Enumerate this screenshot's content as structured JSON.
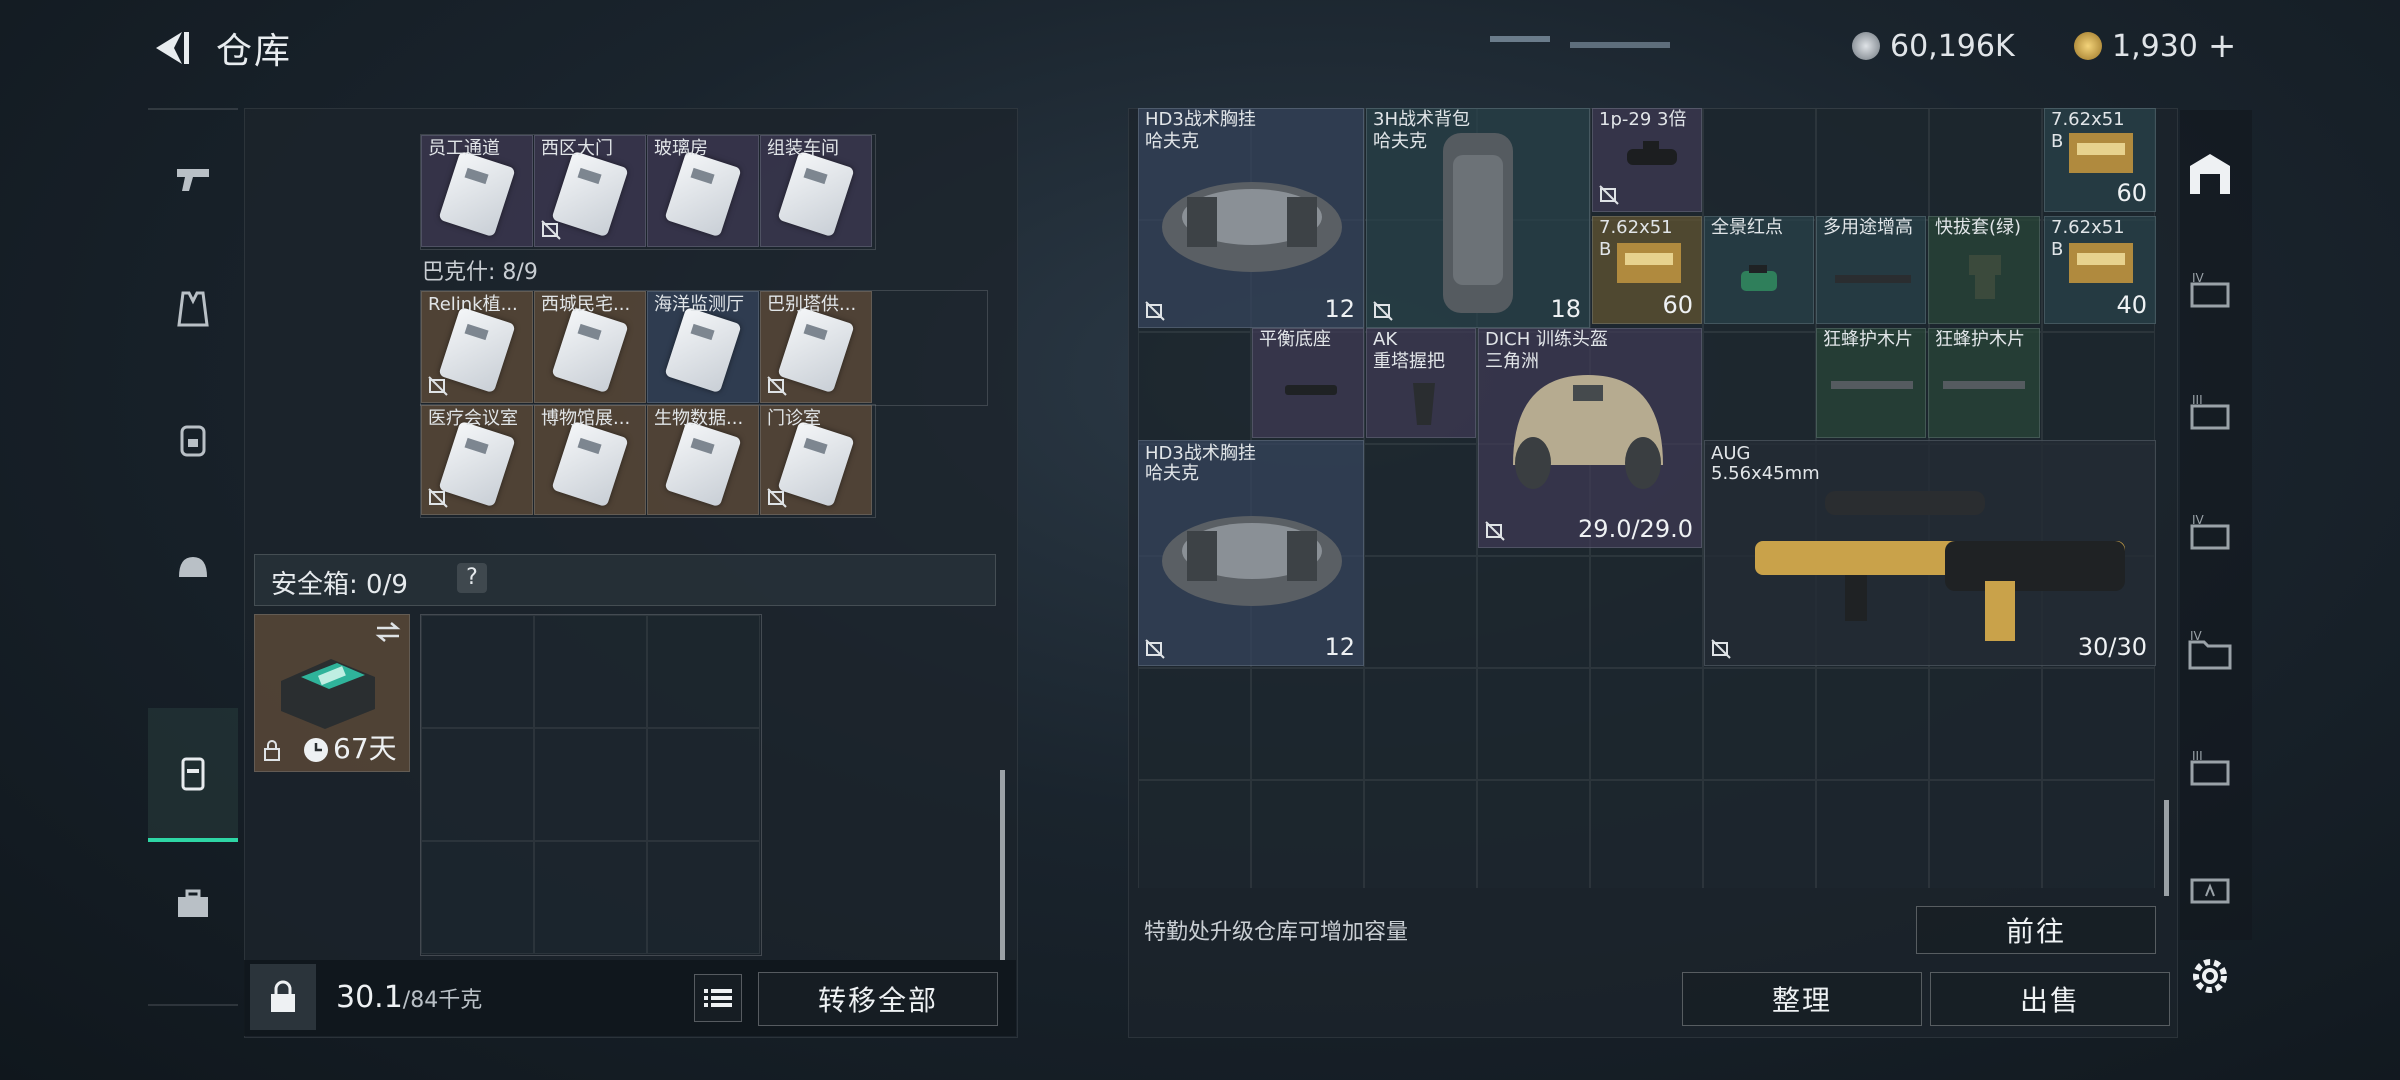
{
  "header": {
    "title": "仓库",
    "currency_silver": "60,196K",
    "currency_gold": "1,930",
    "add_label": "+"
  },
  "left_panel": {
    "keycards_top": [
      "员工通道",
      "西区大门",
      "玻璃房",
      "组装车间"
    ],
    "bakshi_label": "巴克什: 8/9",
    "bakshi_row1": [
      "Relink植...",
      "西城民宅...",
      "海洋监测厅",
      "巴别塔供..."
    ],
    "bakshi_row2": [
      "医疗会议室",
      "博物馆展...",
      "生物数据...",
      "门诊室"
    ],
    "safe_box_label": "安全箱: 0/9",
    "safe_box_help": "?",
    "safe_box_days": "67天",
    "weight_value": "30.1",
    "weight_max": "/84千克",
    "transfer_all": "转移全部"
  },
  "right_panel": {
    "items": {
      "hd3_top_name": "HD3战术胸挂",
      "hd3_top_sub": "哈夫克",
      "hd3_top_count": "12",
      "bag_name": "3H战术背包",
      "bag_sub": "哈夫克",
      "bag_count": "18",
      "scope_name": "1p-29 3倍",
      "ammo_top_right_name": "7.62x51",
      "ammo_top_right_sub": "B",
      "ammo_top_right_count": "60",
      "ammo_mid_name": "7.62x51",
      "ammo_mid_sub": "B",
      "ammo_mid_count": "60",
      "red_dot": "全景红点",
      "riser": "多用途增高",
      "quick_mount": "快拔套(绿)",
      "ammo_right_name": "7.62x51",
      "ammo_right_sub": "B",
      "ammo_right_count": "40",
      "balance_mount": "平衡底座",
      "ak_grip_name": "AK",
      "ak_grip_sub": "重塔握把",
      "helmet_name": "DICH 训练头盔",
      "helmet_sub": "三角洲",
      "helmet_durability": "29.0/29.0",
      "handguard_1": "狂蜂护木片",
      "handguard_2": "狂蜂护木片",
      "hd3_bottom_name": "HD3战术胸挂",
      "hd3_bottom_sub": "哈夫克",
      "hd3_bottom_count": "12",
      "aug_name": "AUG",
      "aug_sub": "5.56x45mm",
      "aug_ammo": "30/30"
    },
    "upgrade_hint": "特勤处升级仓库可增加容量",
    "goto_button": "前往",
    "sort_button": "整理",
    "sell_button": "出售"
  },
  "colors": {
    "accent": "#2ed6a5",
    "gold": "#c9a24a"
  }
}
